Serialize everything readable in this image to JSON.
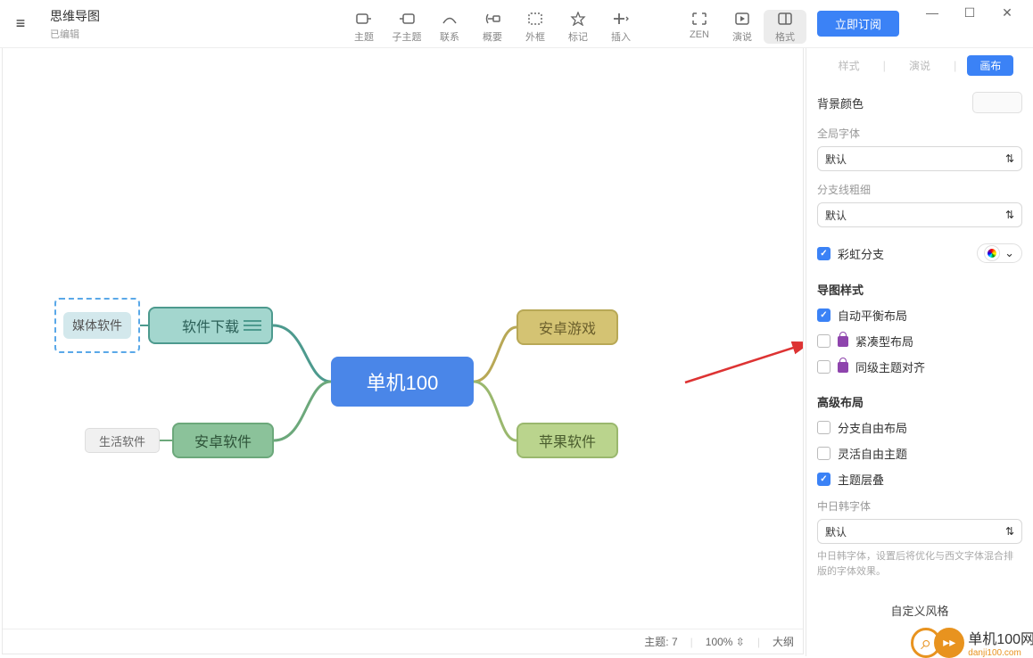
{
  "header": {
    "title": "思维导图",
    "subtitle": "已编辑",
    "tools": [
      {
        "icon": "topic",
        "label": "主题"
      },
      {
        "icon": "subtopic",
        "label": "子主题"
      },
      {
        "icon": "relation",
        "label": "联系"
      },
      {
        "icon": "summary",
        "label": "概要"
      },
      {
        "icon": "boundary",
        "label": "外框"
      },
      {
        "icon": "marker",
        "label": "标记"
      },
      {
        "icon": "insert",
        "label": "插入"
      }
    ],
    "right_tools": [
      {
        "icon": "zen",
        "label": "ZEN"
      },
      {
        "icon": "present",
        "label": "演说"
      },
      {
        "icon": "format",
        "label": "格式"
      }
    ],
    "subscribe": "立即订阅"
  },
  "mindmap": {
    "center": "单机100",
    "nodes": {
      "n1": "软件下载",
      "n1a": "媒体软件",
      "n2": "安卓软件",
      "n2a": "生活软件",
      "n3": "安卓游戏",
      "n4": "苹果软件"
    }
  },
  "status": {
    "topics_label": "主题:",
    "topics_count": "7",
    "zoom": "100%",
    "outline": "大纲"
  },
  "panel": {
    "tabs": [
      "样式",
      "演说",
      "画布"
    ],
    "bg_label": "背景颜色",
    "global_font_label": "全局字体",
    "global_font_value": "默认",
    "branch_width_label": "分支线粗细",
    "branch_width_value": "默认",
    "rainbow_label": "彩虹分支",
    "style_title": "导图样式",
    "style_opts": [
      {
        "label": "自动平衡布局",
        "checked": true,
        "lock": false
      },
      {
        "label": "紧凑型布局",
        "checked": false,
        "lock": true
      },
      {
        "label": "同级主题对齐",
        "checked": false,
        "lock": true
      }
    ],
    "adv_title": "高级布局",
    "adv_opts": [
      {
        "label": "分支自由布局",
        "checked": false
      },
      {
        "label": "灵活自由主题",
        "checked": false
      },
      {
        "label": "主题层叠",
        "checked": true
      }
    ],
    "cjk_label": "中日韩字体",
    "cjk_value": "默认",
    "cjk_hint": "中日韩字体，设置后将优化与西文字体混合排版的字体效果。",
    "custom_btn": "自定义风格"
  },
  "watermark": {
    "text": "单机100网",
    "url": "danji100.com"
  }
}
